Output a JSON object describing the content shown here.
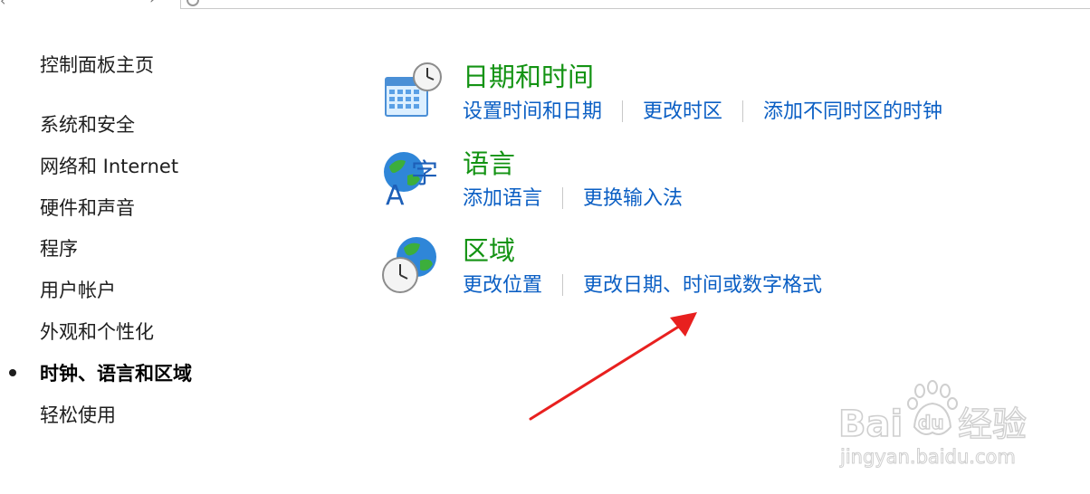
{
  "sidebar": {
    "home": "控制面板主页",
    "items": [
      {
        "label": "系统和安全"
      },
      {
        "label": "网络和 Internet"
      },
      {
        "label": "硬件和声音"
      },
      {
        "label": "程序"
      },
      {
        "label": "用户帐户"
      },
      {
        "label": "外观和个性化"
      },
      {
        "label": "时钟、语言和区域",
        "current": true
      },
      {
        "label": "轻松使用"
      }
    ]
  },
  "categories": [
    {
      "title": "日期和时间",
      "icon": "calendar-clock-icon",
      "links": [
        "设置时间和日期",
        "更改时区",
        "添加不同时区的时钟"
      ]
    },
    {
      "title": "语言",
      "icon": "language-globe-icon",
      "links": [
        "添加语言",
        "更换输入法"
      ]
    },
    {
      "title": "区域",
      "icon": "region-globe-clock-icon",
      "links": [
        "更改位置",
        "更改日期、时间或数字格式"
      ]
    }
  ],
  "watermark": {
    "brand": "Bai",
    "brand_du": "du",
    "suffix": "经验",
    "url": "jingyan.baidu.com"
  },
  "colors": {
    "title_green": "#139313",
    "link_blue": "#0b5fc4",
    "arrow_red": "#e8201f"
  }
}
